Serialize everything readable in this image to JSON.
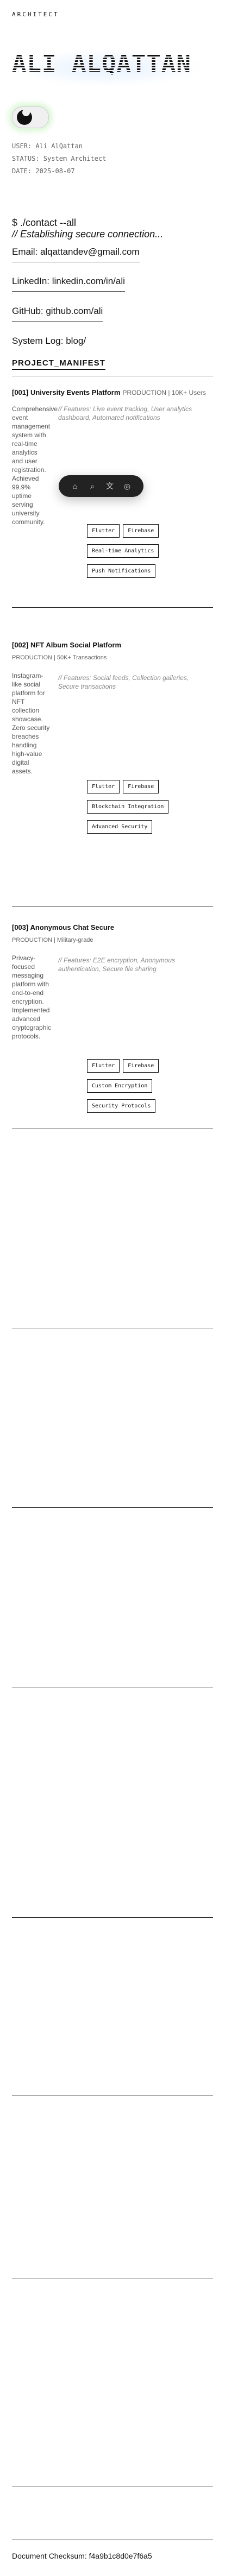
{
  "site": {
    "label": "ARCHITECT"
  },
  "hero": {
    "name": "ALI ALQATTAN"
  },
  "meta": {
    "user": "USER: Ali AlQattan",
    "status": "STATUS: System Architect",
    "date": "DATE: 2025-08-07"
  },
  "contact": {
    "command": "$ ./contact --all",
    "comment": "// Establishing secure connection...",
    "email": "Email: alqattandev@gmail.com",
    "linkedin": "LinkedIn: linkedin.com/in/ali",
    "github": "GitHub: github.com/ali",
    "syslog": "System Log: blog/"
  },
  "manifest_title": "PROJECT_MANIFEST",
  "float_bar": {
    "icons": [
      "home-icon",
      "search-icon",
      "translate-icon",
      "circle-icon"
    ]
  },
  "projects": [
    {
      "title": "[001] University Events Platform",
      "tag": "PRODUCTION | 10K+ Users",
      "desc": "Comprehensive event management system with real-time analytics and user registration. Achieved 99.9% uptime serving university community.",
      "features": "// Features: Live event tracking, User analytics dashboard, Automated notifications",
      "chips": [
        "Flutter",
        "Firebase",
        "Real-time Analytics",
        "Push Notifications"
      ]
    },
    {
      "title": "[002] NFT Album Social Platform",
      "tag": "PRODUCTION | 50K+ Transactions",
      "desc": "Instagram-like social platform for NFT collection showcase. Zero security breaches handling high-value digital assets.",
      "features": "// Features: Social feeds, Collection galleries, Secure transactions",
      "chips": [
        "Flutter",
        "Firebase",
        "Blockchain Integration",
        "Advanced Security"
      ]
    },
    {
      "title": "[003] Anonymous Chat Secure",
      "tag": "PRODUCTION | Military-grade",
      "desc": "Privacy-focused messaging platform with end-to-end encryption. Implemented advanced cryptographic protocols.",
      "features": "// Features: E2E encryption, Anonymous authentication, Secure file sharing",
      "chips": [
        "Flutter",
        "Firebase",
        "Custom Encryption",
        "Security Protocols"
      ]
    }
  ],
  "checksum": "Document Checksum: f4a9b1c8d0e7f6a5"
}
